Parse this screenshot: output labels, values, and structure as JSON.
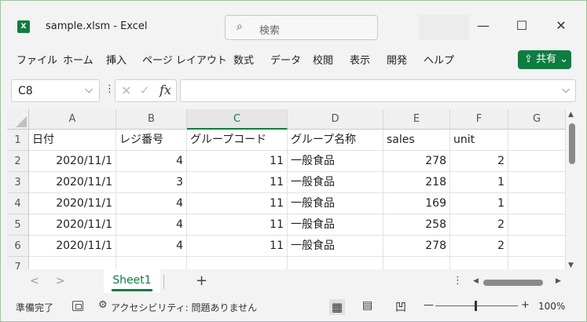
{
  "titlebar": {
    "app_icon": "X",
    "title": "sample.xlsm  -  Excel",
    "search_icon": "⌕",
    "search_placeholder": "検索",
    "minimize": "—",
    "maximize": "☐",
    "close": "✕"
  },
  "menu": {
    "items": [
      "ファイル",
      "ホーム",
      "挿入",
      "ページ レイアウト",
      "数式",
      "データ",
      "校閲",
      "表示",
      "開発",
      "ヘルプ"
    ],
    "share_label": "⇪ 共有 ⌄"
  },
  "formula_bar": {
    "name_box": "C8",
    "name_arrow": "⌵",
    "dots": "⋮",
    "cancel": "✕",
    "enter": "✓",
    "fx": "fx",
    "formula": "",
    "expand_arrow": "⌵"
  },
  "grid": {
    "columns": [
      "A",
      "B",
      "C",
      "D",
      "E",
      "F",
      "G"
    ],
    "active_column": "C",
    "row_numbers": [
      "1",
      "2",
      "3",
      "4",
      "5",
      "6",
      "7"
    ],
    "rows": [
      [
        "日付",
        "レジ番号",
        "グループコード",
        "グループ名称",
        "sales",
        "unit",
        ""
      ],
      [
        "2020/11/1",
        "4",
        "11",
        "一般食品",
        "278",
        "2",
        ""
      ],
      [
        "2020/11/1",
        "3",
        "11",
        "一般食品",
        "218",
        "1",
        ""
      ],
      [
        "2020/11/1",
        "4",
        "11",
        "一般食品",
        "169",
        "1",
        ""
      ],
      [
        "2020/11/1",
        "4",
        "11",
        "一般食品",
        "258",
        "2",
        ""
      ],
      [
        "2020/11/1",
        "4",
        "11",
        "一般食品",
        "278",
        "2",
        ""
      ],
      [
        "",
        "",
        "",
        "",
        "",
        "",
        ""
      ]
    ]
  },
  "scroll": {
    "up": "▲",
    "down": "▼",
    "left": "◀",
    "right": "▶",
    "dots": "⋮"
  },
  "sheets": {
    "prev": "<",
    "next": ">",
    "tabs": [
      "Sheet1"
    ],
    "add": "+"
  },
  "status": {
    "ready": "準備完了",
    "accessibility_icon": "⚙",
    "accessibility": "アクセシビリティ: 問題ありません",
    "view_normal": "▦",
    "view_layout": "▤",
    "view_break": "凹",
    "zoom_minus": "—",
    "zoom_plus": "+",
    "zoom": "100%"
  },
  "colors": {
    "accent": "#107c41"
  }
}
